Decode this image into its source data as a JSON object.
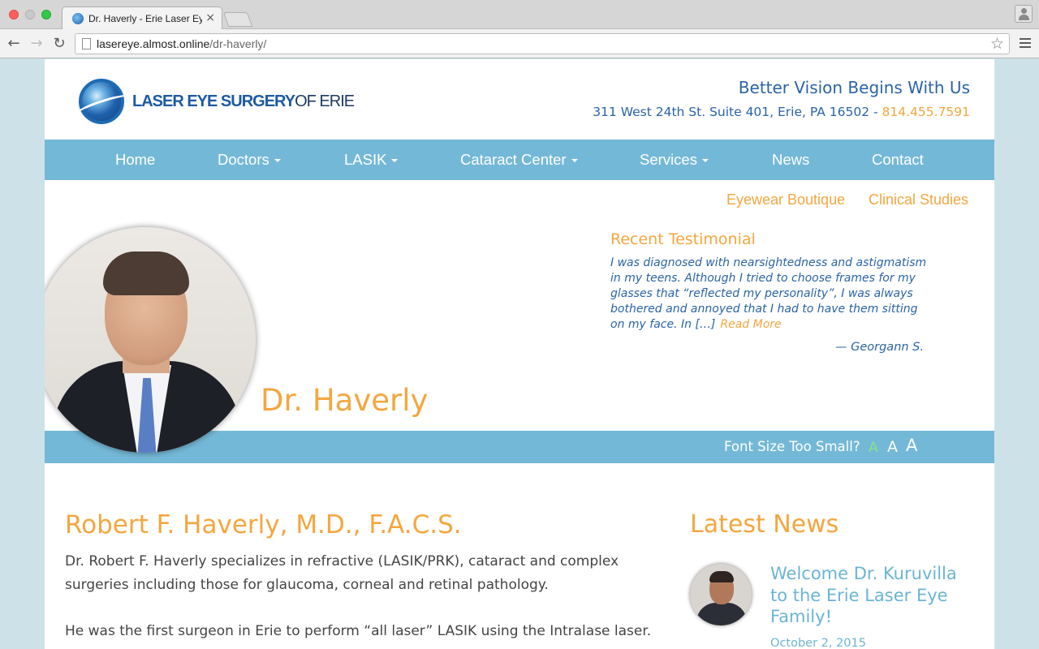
{
  "browser": {
    "tab_title": "Dr. Haverly - Erie Laser Eye",
    "tab_close": "×",
    "url_host": "lasereye.almost.online",
    "url_path": "/dr-haverly/",
    "icons": [
      "back-arrow-icon",
      "forward-arrow-icon",
      "reload-icon",
      "page-icon",
      "star-icon",
      "menu-icon",
      "profile-icon"
    ]
  },
  "header": {
    "logo_primary": "LASER EYE SURGERY",
    "logo_secondary": "OF ERIE",
    "tagline": "Better Vision Begins With Us",
    "address": "311 West 24th St. Suite 401, Erie, PA 16502 - ",
    "phone": "814.455.7591"
  },
  "nav": {
    "items": [
      {
        "label": "Home",
        "has_dropdown": false
      },
      {
        "label": "Doctors",
        "has_dropdown": true
      },
      {
        "label": "LASIK",
        "has_dropdown": true
      },
      {
        "label": "Cataract Center",
        "has_dropdown": true
      },
      {
        "label": "Services",
        "has_dropdown": true
      },
      {
        "label": "News",
        "has_dropdown": false
      },
      {
        "label": "Contact",
        "has_dropdown": false
      }
    ],
    "sub_items": [
      "Eyewear Boutique",
      "Clinical Studies"
    ]
  },
  "hero": {
    "doctor_name": "Dr. Haverly"
  },
  "testimonial": {
    "heading": "Recent Testimonial",
    "text": "I was diagnosed with nearsightedness and astigmatism in my teens. Although I tried to choose frames for my glasses that “reflected my personality”, I was always bothered and annoyed that I had to have them sitting on my face. In […]",
    "read_more": "Read More",
    "author": "— Georgann S."
  },
  "font_size_bar": {
    "label": "Font Size Too Small?",
    "small": "A",
    "medium": "A",
    "large": "A"
  },
  "bio": {
    "title": "Robert F. Haverly, M.D., F.A.C.S.",
    "paragraph_1": "Dr. Robert F. Haverly specializes in refractive (LASIK/PRK), cataract and complex surgeries including those for glaucoma, corneal and retinal pathology.",
    "paragraph_2": "He was the first surgeon in Erie to perform “all laser” LASIK using the Intralase laser."
  },
  "news": {
    "heading": "Latest News",
    "item_title": "Welcome Dr. Kuruvilla to the Erie Laser Eye Family!",
    "item_date": "October 2, 2015"
  },
  "colors": {
    "accent_orange": "#f4a63f",
    "nav_blue": "#74b8d7",
    "text_blue": "#2a63a6",
    "news_blue": "#6bb4d3",
    "page_background": "#cde2e8"
  }
}
